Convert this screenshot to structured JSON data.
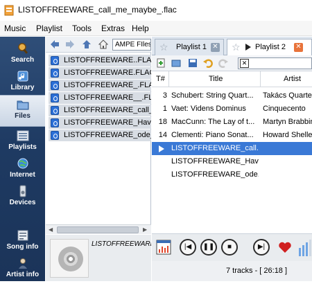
{
  "window": {
    "title": "LISTOFFREEWARE_call_me_maybe_.flac"
  },
  "menu": [
    "Music",
    "Playlist",
    "Tools",
    "Extras",
    "Help"
  ],
  "sidebar": {
    "items": [
      {
        "label": "Search",
        "icon": "search-icon"
      },
      {
        "label": "Library",
        "icon": "library-icon"
      },
      {
        "label": "Files",
        "icon": "files-icon",
        "active": true
      },
      {
        "label": "Playlists",
        "icon": "playlists-icon"
      },
      {
        "label": "Internet",
        "icon": "internet-icon"
      },
      {
        "label": "Devices",
        "icon": "devices-icon"
      },
      {
        "label": "Song info",
        "icon": "song-info-icon"
      },
      {
        "label": "Artist info",
        "icon": "artist-info-icon"
      }
    ]
  },
  "files": {
    "path": "AMPE FIles",
    "list": [
      "LISTOFFREEWARE..FLAC",
      "LISTOFFREEWARE.FLAC",
      "LISTOFFREEWARE_.FLAC",
      "LISTOFFREEWARE__.FLAC",
      "LISTOFFREEWARE_call_m",
      "LISTOFFREEWARE_Hava",
      "LISTOFFREEWARE_ode_t"
    ]
  },
  "now_playing": {
    "title": "LISTOFFREEWARE_call_"
  },
  "playlist": {
    "tabs": [
      {
        "label": "Playlist 1",
        "active": false
      },
      {
        "label": "Playlist 2",
        "active": true
      }
    ],
    "columns": {
      "num": "T#",
      "title": "Title",
      "artist": "Artist"
    },
    "tracks": [
      {
        "num": "3",
        "title": "Schubert: String Quart...",
        "artist": "Takács Quartet"
      },
      {
        "num": "1",
        "title": "Vaet: Videns Dominus",
        "artist": "Cinquecento"
      },
      {
        "num": "18",
        "title": "MacCunn: The Lay of t...",
        "artist": "Martyn Brabbins"
      },
      {
        "num": "14",
        "title": "Clementi: Piano Sonat...",
        "artist": "Howard Shelley"
      },
      {
        "num": "",
        "title": "LISTOFFREEWARE_call...",
        "artist": "",
        "playing": true
      },
      {
        "num": "",
        "title": "LISTOFFREEWARE_Hav...",
        "artist": ""
      },
      {
        "num": "",
        "title": "LISTOFFREEWARE_ode...",
        "artist": ""
      }
    ],
    "status": "7 tracks - [ 26:18 ]"
  },
  "colors": {
    "sidebar": "#1e3a62",
    "selection": "#3a79d6",
    "tab_close_inactive": "#8fa0b4",
    "tab_close_active": "#e8733a"
  }
}
